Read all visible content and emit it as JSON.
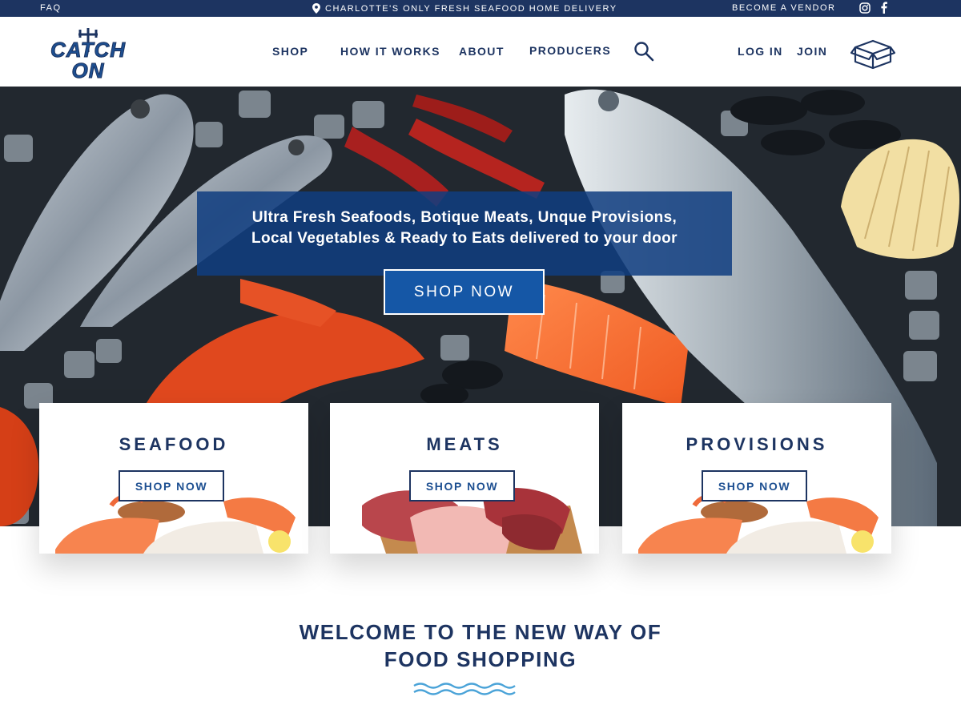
{
  "topbar": {
    "faq": "FAQ",
    "promo": "CHARLOTTE'S ONLY FRESH SEAFOOD HOME DELIVERY",
    "vendor": "BECOME A VENDOR",
    "social": [
      "instagram-icon",
      "facebook-icon"
    ]
  },
  "brand": {
    "line1": "CATCH",
    "line2": "ON"
  },
  "nav": {
    "shop": "SHOP",
    "how": "HOW IT WORKS",
    "about": "ABOUT",
    "producers": "PRODUCERS",
    "login": "LOG IN",
    "join": "JOIN"
  },
  "hero": {
    "line1": "Ultra Fresh Seafoods, Botique Meats, Unque Provisions,",
    "line2": "Local Vegetables & Ready to Eats delivered to your door",
    "cta": "SHOP NOW"
  },
  "categories": [
    {
      "title": "SEAFOOD",
      "button": "SHOP NOW"
    },
    {
      "title": "MEATS",
      "button": "SHOP NOW"
    },
    {
      "title": "PROVISIONS",
      "button": "SHOP NOW"
    }
  ],
  "welcome": {
    "line1": "WELCOME TO THE NEW WAY OF",
    "line2": "FOOD SHOPPING"
  },
  "colors": {
    "navy": "#1d3461",
    "accent_blue": "#1557a6",
    "wave_blue": "#4aa3d8"
  }
}
